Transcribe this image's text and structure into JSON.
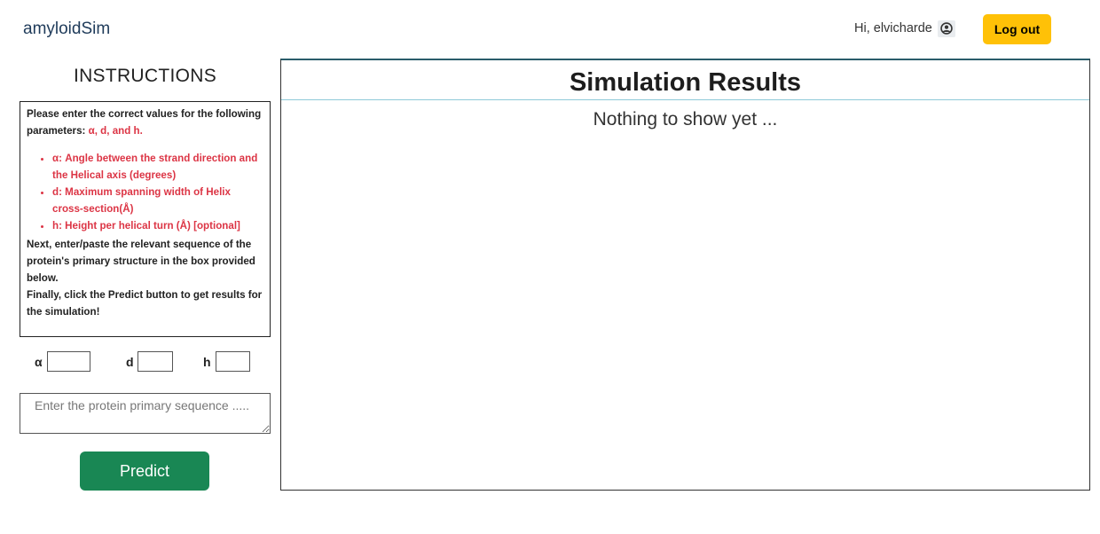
{
  "navbar": {
    "brand": "amyloidSim",
    "greeting": "Hi, elvicharde",
    "user_icon": "user-circle-icon",
    "logout_label": "Log out",
    "logout_color": "#ffc107"
  },
  "instructions": {
    "title": "INSTRUCTIONS",
    "intro": "Please enter the correct values for the following parameters: ",
    "intro_params": "α, d, and h.",
    "items": [
      "α: Angle between the strand direction and the Helical axis (degrees)",
      "d: Maximum spanning width of Helix cross-section(Å)",
      "h: Height per helical turn (Å) [optional]"
    ],
    "next": "Next, enter/paste the relevant sequence of the protein's primary structure in the box provided below.",
    "finally": "Finally, click the Predict button to get results for the simulation!"
  },
  "params": {
    "alpha_label": "α",
    "alpha_value": "",
    "d_label": "d",
    "d_value": "",
    "h_label": "h",
    "h_value": ""
  },
  "sequence": {
    "placeholder": "Enter the protein primary sequence .....",
    "value": ""
  },
  "predict_label": "Predict",
  "predict_color": "#198754",
  "results": {
    "title": "Simulation Results",
    "empty_message": "Nothing to show yet ..."
  }
}
